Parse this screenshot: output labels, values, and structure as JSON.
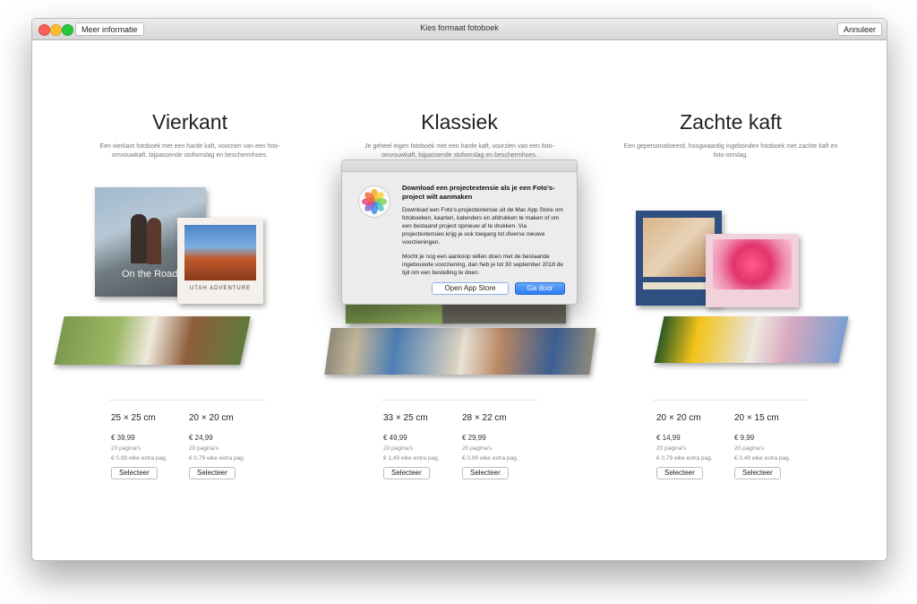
{
  "window": {
    "title": "Kies formaat fotoboek",
    "info_button": "Meer informatie",
    "cancel_button": "Annuleer"
  },
  "columns": [
    {
      "title": "Vierkant",
      "description": "Een vierkant fotoboek met een harde kaft, voorzien van een foto-omvouwkaft, bijpassende stofomslag en beschermhoes.",
      "cover_texts": [
        "On the Road",
        "UTAH ADVENTURE"
      ],
      "sizes": [
        {
          "dim": "25 × 25 cm",
          "price": "€ 39,99",
          "pages": "20 pagina's",
          "extra": "€ 0,99 elke extra pag.",
          "button": "Selecteer"
        },
        {
          "dim": "20 × 20 cm",
          "price": "€ 24,99",
          "pages": "20 pagina's",
          "extra": "€ 0,79 elke extra pag.",
          "button": "Selecteer"
        }
      ]
    },
    {
      "title": "Klassiek",
      "description": "Je geheel eigen fotoboek met een harde kaft, voorzien van een foto-omvouwkaft, bijpassende stofomslag en beschermhoes.",
      "sizes": [
        {
          "dim": "33 × 25 cm",
          "price": "€ 49,99",
          "pages": "20 pagina's",
          "extra": "€ 1,49 elke extra pag.",
          "button": "Selecteer"
        },
        {
          "dim": "28 × 22 cm",
          "price": "€ 29,99",
          "pages": "20 pagina's",
          "extra": "€ 0,99 elke extra pag.",
          "button": "Selecteer"
        }
      ]
    },
    {
      "title": "Zachte kaft",
      "description": "Een gepersonaliseerd, hoogwaardig ingebonden fotoboek met zachte kaft en foto-omslag.",
      "sizes": [
        {
          "dim": "20 × 20 cm",
          "price": "€ 14,99",
          "pages": "20 pagina's",
          "extra": "€ 0,79 elke extra pag.",
          "button": "Selecteer"
        },
        {
          "dim": "20 × 15 cm",
          "price": "€ 9,99",
          "pages": "20 pagina's",
          "extra": "€ 0,49 elke extra pag.",
          "button": "Selecteer"
        }
      ]
    }
  ],
  "dialog": {
    "icon": "photos-app-icon",
    "title": "Download een projectextensie als je een Foto's-project wilt aanmaken",
    "body": "Download een Foto's-projectextensie uit de Mac App Store om fotoboeken, kaarten, kalenders en afdrukken te maken of om een bestaand project opnieuw af te drukken. Via projectextensies krijg je ook toegang tot diverse nieuwe voorzieningen.",
    "body2": "Mocht je nog een aankoop willen doen met de bestaande ingebouwde voorziening, dan heb je tot 30 september 2018 de tijd om een bestelling te doen.",
    "open_button": "Open App Store",
    "go_button": "Ga door"
  },
  "colors": {
    "accent": "#2e7cf6",
    "close": "#fc5f57",
    "minimize": "#fdbc2e",
    "maximize": "#28c840"
  }
}
